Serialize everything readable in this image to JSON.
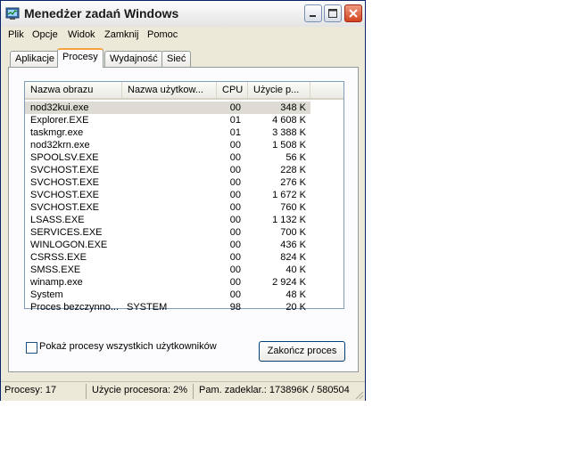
{
  "window": {
    "title": "Menedżer zadań Windows"
  },
  "menu": [
    "Plik",
    "Opcje",
    "Widok",
    "Zamknij",
    "Pomoc"
  ],
  "tabs": [
    "Aplikacje",
    "Procesy",
    "Wydajność",
    "Sieć"
  ],
  "active_tab": "Procesy",
  "columns": [
    "Nazwa obrazu",
    "Nazwa użytkow...",
    "CPU",
    "Użycie p..."
  ],
  "processes": [
    {
      "name": "nod32kui.exe",
      "user": "",
      "cpu": "00",
      "mem": "348 K"
    },
    {
      "name": "Explorer.EXE",
      "user": "",
      "cpu": "01",
      "mem": "4 608 K"
    },
    {
      "name": "taskmgr.exe",
      "user": "",
      "cpu": "01",
      "mem": "3 388 K"
    },
    {
      "name": "nod32krn.exe",
      "user": "",
      "cpu": "00",
      "mem": "1 508 K"
    },
    {
      "name": "SPOOLSV.EXE",
      "user": "",
      "cpu": "00",
      "mem": "56 K"
    },
    {
      "name": "SVCHOST.EXE",
      "user": "",
      "cpu": "00",
      "mem": "228 K"
    },
    {
      "name": "SVCHOST.EXE",
      "user": "",
      "cpu": "00",
      "mem": "276 K"
    },
    {
      "name": "SVCHOST.EXE",
      "user": "",
      "cpu": "00",
      "mem": "1 672 K"
    },
    {
      "name": "SVCHOST.EXE",
      "user": "",
      "cpu": "00",
      "mem": "760 K"
    },
    {
      "name": "LSASS.EXE",
      "user": "",
      "cpu": "00",
      "mem": "1 132 K"
    },
    {
      "name": "SERVICES.EXE",
      "user": "",
      "cpu": "00",
      "mem": "700 K"
    },
    {
      "name": "WINLOGON.EXE",
      "user": "",
      "cpu": "00",
      "mem": "436 K"
    },
    {
      "name": "CSRSS.EXE",
      "user": "",
      "cpu": "00",
      "mem": "824 K"
    },
    {
      "name": "SMSS.EXE",
      "user": "",
      "cpu": "00",
      "mem": "40 K"
    },
    {
      "name": "winamp.exe",
      "user": "",
      "cpu": "00",
      "mem": "2 924 K"
    },
    {
      "name": "System",
      "user": "",
      "cpu": "00",
      "mem": "48 K"
    },
    {
      "name": "Proces bezczynno...",
      "user": "SYSTEM",
      "cpu": "98",
      "mem": "20 K"
    }
  ],
  "selected_index": 0,
  "checkbox_label": "Pokaż procesy wszystkich użytkowników",
  "end_button": "Zakończ proces",
  "status": {
    "processes": "Procesy: 17",
    "cpu": "Użycie procesora: 2%",
    "mem": "Pam. zadeklar.: 173896K / 580504"
  },
  "colors": {
    "close_button": "#d3431f",
    "active_tab_accent": "#f5a341",
    "selection": "#dddbd3"
  }
}
